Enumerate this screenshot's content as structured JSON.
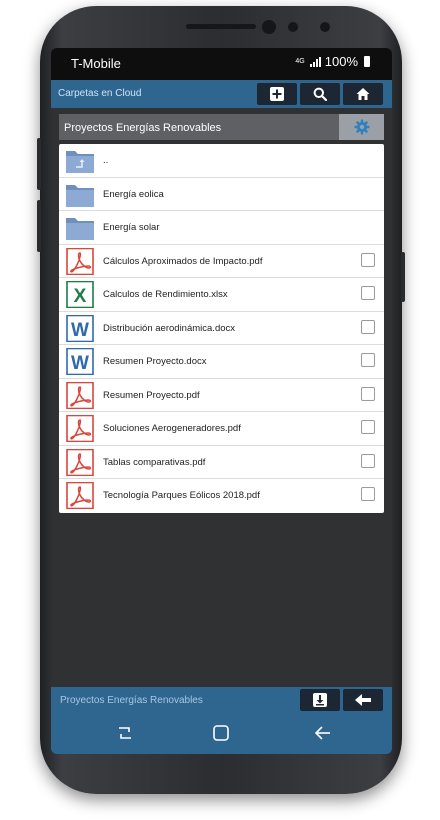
{
  "status": {
    "carrier": "T-Mobile",
    "network": "4G",
    "battery": "100%"
  },
  "header": {
    "title": "Carpetas en Cloud"
  },
  "folder": {
    "title": "Proyectos Energías Renovables"
  },
  "files": [
    {
      "name": "..",
      "type": "folder-up",
      "checkbox": false
    },
    {
      "name": "Energía eolica",
      "type": "folder",
      "checkbox": false
    },
    {
      "name": "Energía solar",
      "type": "folder",
      "checkbox": false
    },
    {
      "name": "Cálculos Aproximados de Impacto.pdf",
      "type": "pdf",
      "checkbox": true
    },
    {
      "name": "Calculos de Rendimiento.xlsx",
      "type": "excel",
      "checkbox": true
    },
    {
      "name": "Distribución aerodinámica.docx",
      "type": "word",
      "checkbox": true
    },
    {
      "name": "Resumen Proyecto.docx",
      "type": "word",
      "checkbox": true
    },
    {
      "name": "Resumen Proyecto.pdf",
      "type": "pdf",
      "checkbox": true
    },
    {
      "name": "Soluciones Aerogeneradores.pdf",
      "type": "pdf",
      "checkbox": true
    },
    {
      "name": "Tablas comparativas.pdf",
      "type": "pdf",
      "checkbox": true
    },
    {
      "name": "Tecnología Parques Eólicos 2018.pdf",
      "type": "pdf",
      "checkbox": true
    }
  ],
  "footer": {
    "title": "Proyectos Energías Renovables"
  },
  "icons": {
    "add": "plus-icon",
    "search": "search-icon",
    "home": "home-icon",
    "settings": "gear-icon",
    "download": "download-icon",
    "back": "arrow-left-icon"
  },
  "colors": {
    "bar": "#2e6690",
    "button": "#1c2733",
    "pdf": "#d9473c",
    "excel": "#1e7d45",
    "word": "#2e6aae"
  }
}
